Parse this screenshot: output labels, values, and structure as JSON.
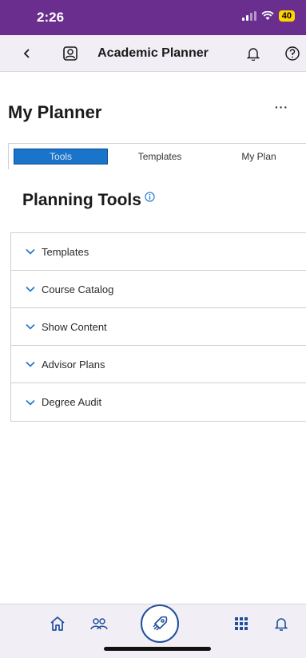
{
  "status_bar": {
    "time": "2:26",
    "battery": "40"
  },
  "nav": {
    "title": "Academic Planner",
    "icons": [
      "back-icon",
      "contact-card-icon",
      "bell-icon",
      "help-icon"
    ]
  },
  "page": {
    "title": "My Planner",
    "more": "···"
  },
  "tabs": [
    {
      "label": "Tools",
      "active": true
    },
    {
      "label": "Templates",
      "active": false
    },
    {
      "label": "My Plan",
      "active": false
    }
  ],
  "tools": {
    "title": "Planning Tools"
  },
  "accordion": [
    "Templates",
    "Course Catalog",
    "Show Content",
    "Advisor Plans",
    "Degree Audit"
  ],
  "bottom_bar": {
    "icons": [
      "home-icon",
      "people-icon",
      "rocket-icon",
      "apps-grid-icon",
      "bell-icon"
    ]
  },
  "colors": {
    "accent": "#1a74c9",
    "status_bar": "#6a2e8e",
    "nav_bg": "#f1eff5"
  }
}
